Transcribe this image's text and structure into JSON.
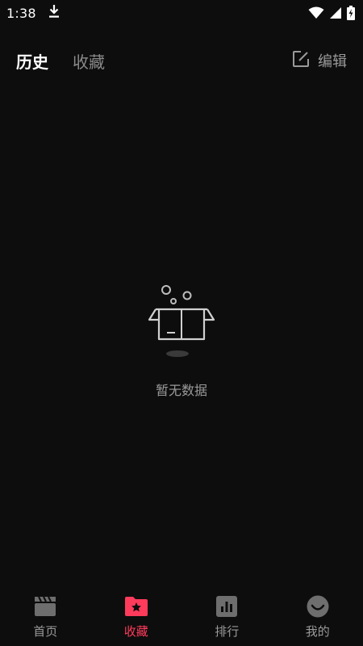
{
  "status_bar": {
    "time": "1:38",
    "icons": [
      "download-icon",
      "wifi-icon",
      "signal-icon",
      "battery-charging-icon"
    ]
  },
  "header": {
    "tabs": [
      {
        "label": "历史",
        "active": true
      },
      {
        "label": "收藏",
        "active": false
      }
    ],
    "edit_label": "编辑",
    "edit_icon": "edit-icon"
  },
  "empty_state": {
    "icon": "empty-box-icon",
    "text": "暂无数据"
  },
  "bottom_nav": {
    "items": [
      {
        "label": "首页",
        "icon": "clapperboard-icon",
        "active": false
      },
      {
        "label": "收藏",
        "icon": "star-folder-icon",
        "active": true
      },
      {
        "label": "排行",
        "icon": "ranking-chart-icon",
        "active": false
      },
      {
        "label": "我的",
        "icon": "smiley-icon",
        "active": false
      }
    ]
  },
  "colors": {
    "background": "#0d0d0d",
    "accent": "#ff3b5c",
    "inactive_icon": "#6e6e6e",
    "inactive_text": "#9a9a9a"
  }
}
